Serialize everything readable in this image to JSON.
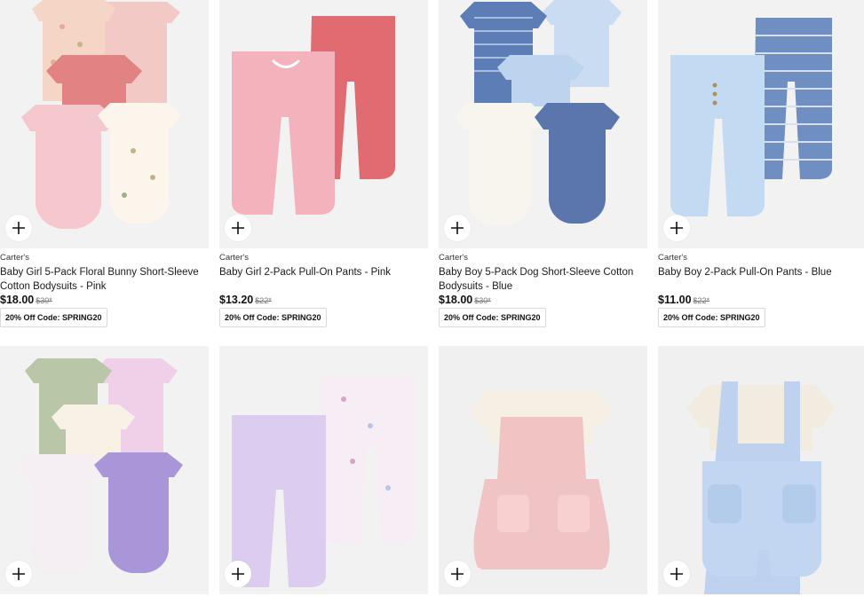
{
  "products": [
    {
      "brand": "Carter's",
      "title": "Baby Girl 5-Pack Floral Bunny Short-Sleeve Cotton Bodysuits - Pink",
      "price": "$18.00",
      "was": "$30*",
      "promo": "20% Off Code: SPRING20",
      "add_label": "+"
    },
    {
      "brand": "Carter's",
      "title": "Baby Girl 2-Pack Pull-On Pants - Pink",
      "price": "$13.20",
      "was": "$22*",
      "promo": "20% Off Code: SPRING20",
      "add_label": "+"
    },
    {
      "brand": "Carter's",
      "title": "Baby Boy 5-Pack Dog Short-Sleeve Cotton Bodysuits - Blue",
      "price": "$18.00",
      "was": "$30*",
      "promo": "20% Off Code: SPRING20",
      "add_label": "+"
    },
    {
      "brand": "Carter's",
      "title": "Baby Boy 2-Pack Pull-On Pants - Blue",
      "price": "$11.00",
      "was": "$22*",
      "promo": "20% Off Code: SPRING20",
      "add_label": "+"
    },
    {
      "add_label": "+"
    },
    {
      "add_label": "+"
    },
    {
      "add_label": "+"
    },
    {
      "add_label": "+"
    }
  ],
  "icons": {
    "add": "plus-icon"
  },
  "colors": {
    "image_bg": "#f2f2f2",
    "border": "#d9d9d9",
    "text": "#1a1a1a"
  }
}
